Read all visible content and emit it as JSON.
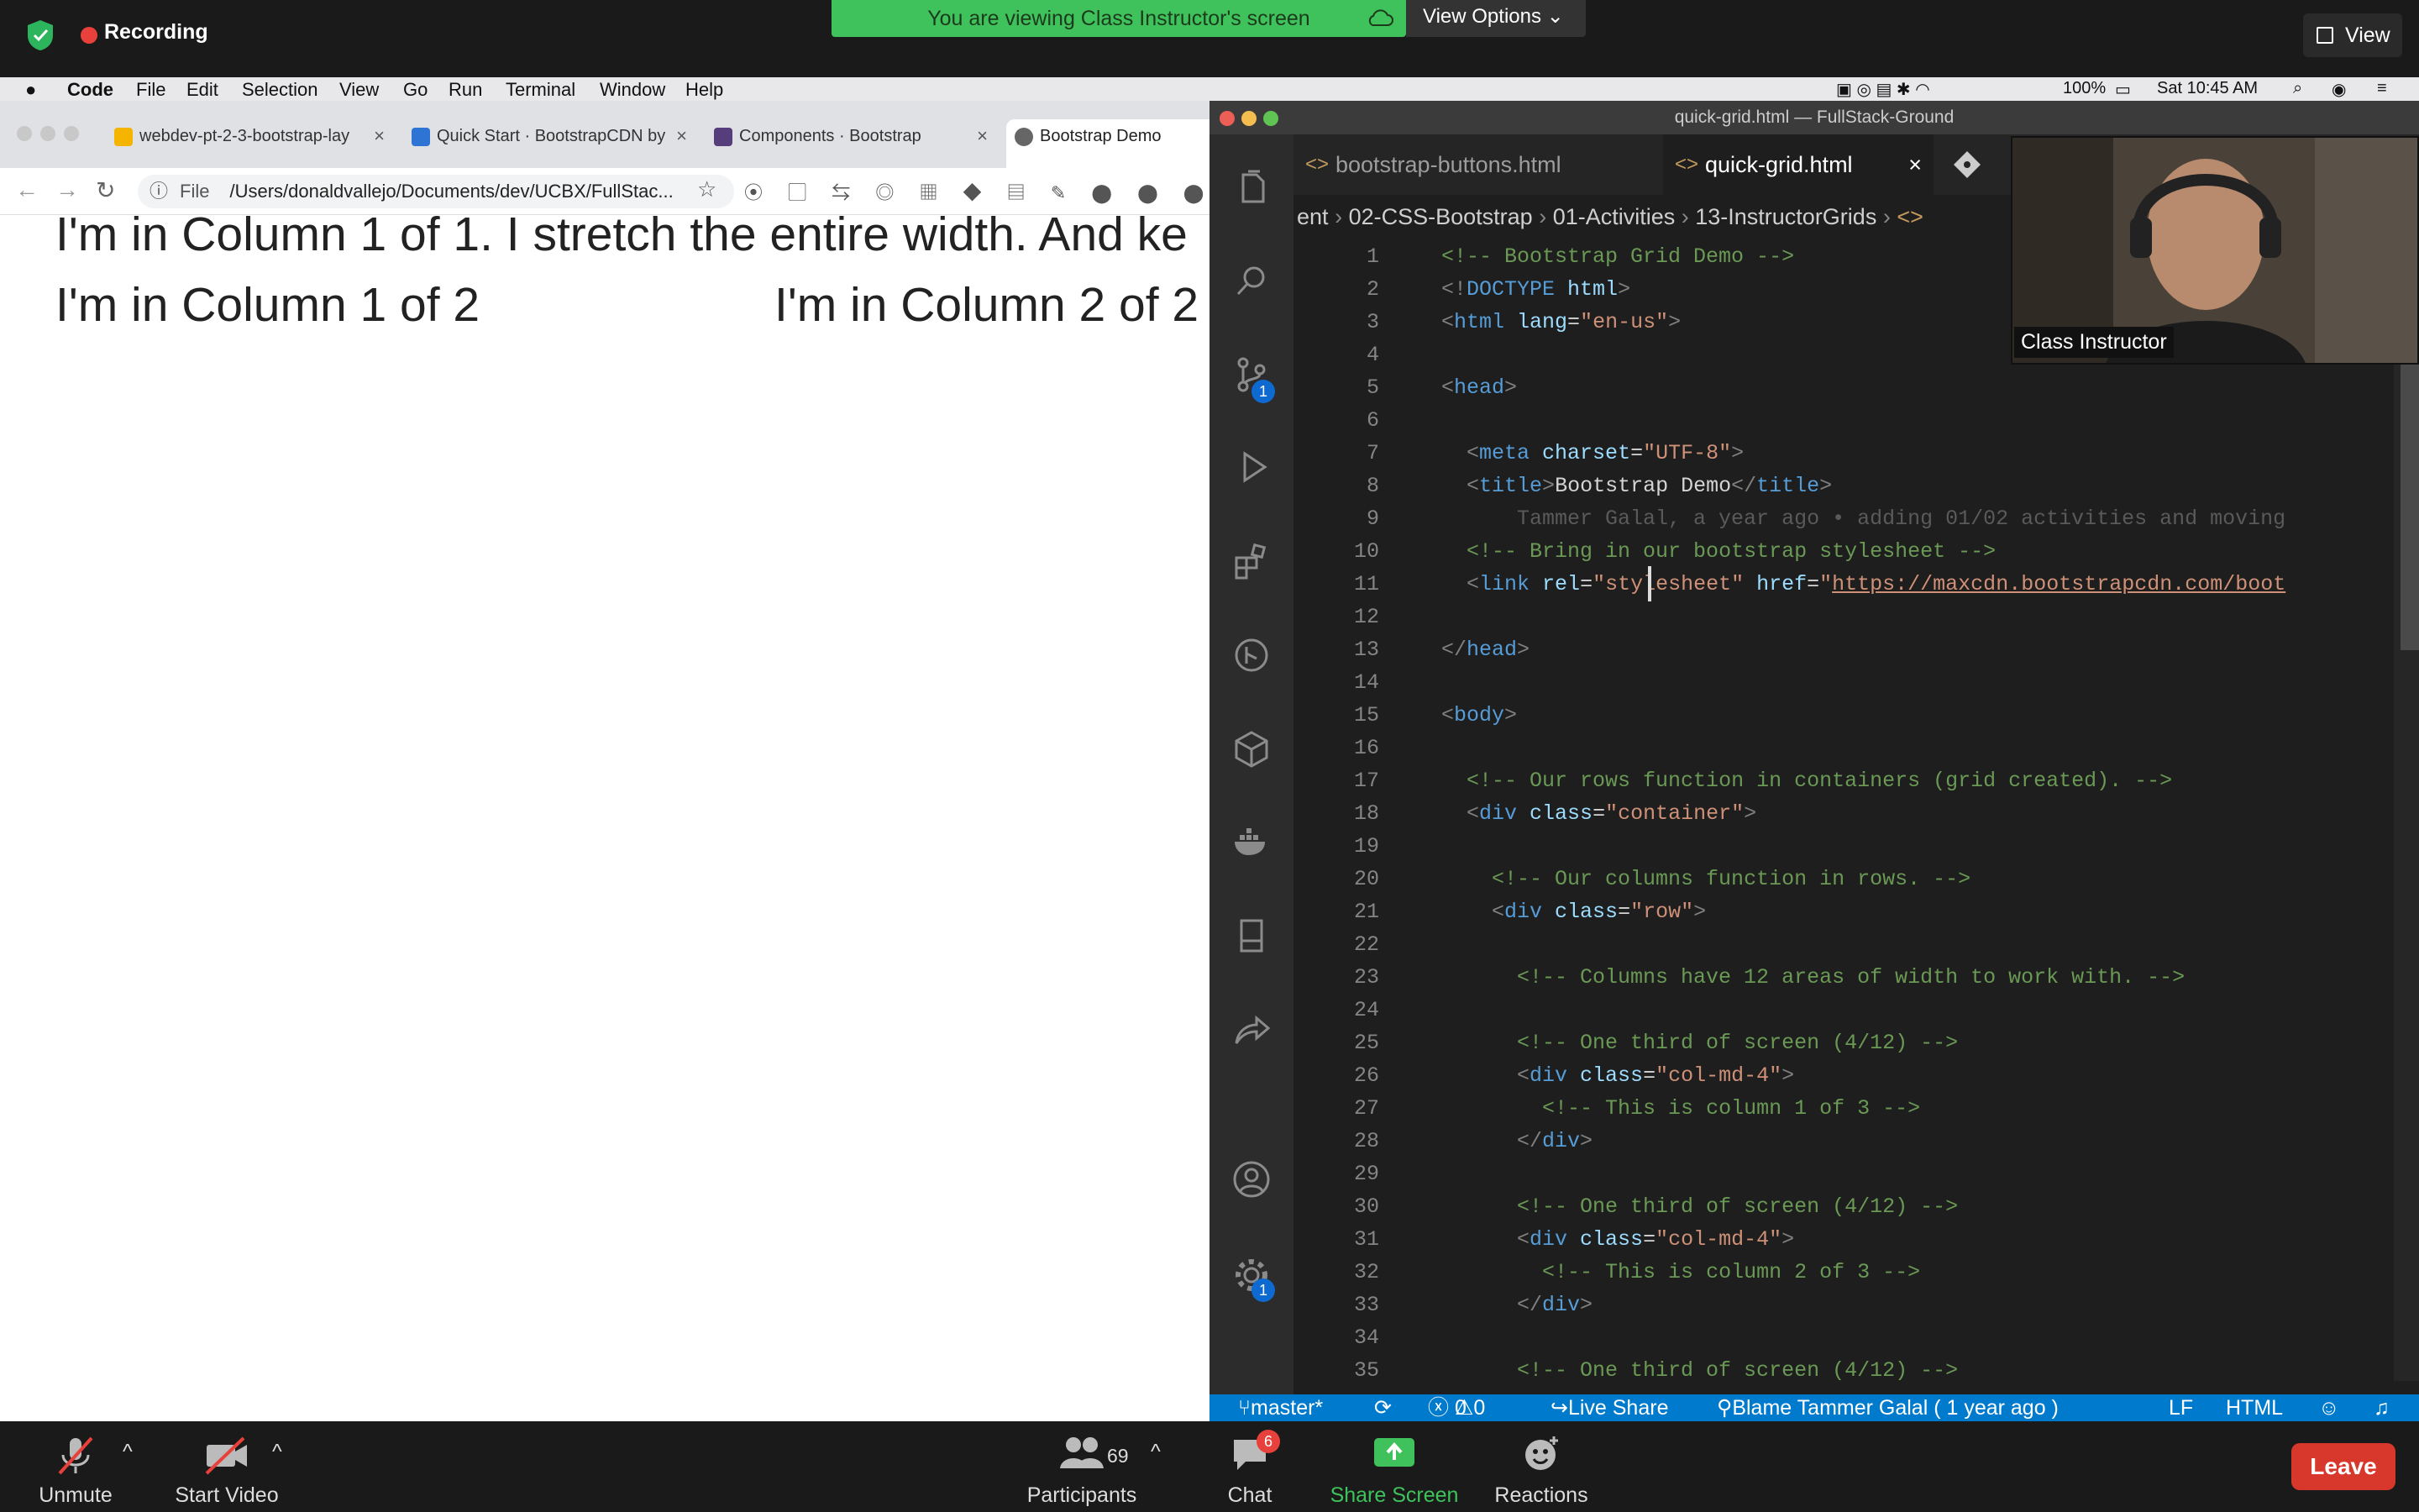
{
  "zoom_top": {
    "recording_label": "Recording",
    "viewing_banner": "You are viewing Class Instructor's screen",
    "view_options": "View Options",
    "view_button": "View"
  },
  "mac_menu": {
    "app": "Code",
    "items": [
      "File",
      "Edit",
      "Selection",
      "View",
      "Go",
      "Run",
      "Terminal",
      "Window",
      "Help"
    ],
    "battery": "100%",
    "clock": "Sat 10:45 AM"
  },
  "chrome": {
    "tabs": [
      {
        "label": "webdev-pt-2-3-bootstrap-lay"
      },
      {
        "label": "Quick Start · BootstrapCDN by"
      },
      {
        "label": "Components · Bootstrap"
      },
      {
        "label": "Bootstrap Demo"
      }
    ],
    "url_protocol": "File",
    "url": "/Users/donaldvallejo/Documents/dev/UCBX/FullStac...",
    "page_lines": [
      "I'm in Column 1 of 1. I stretch the entire width. And ke",
      "I'm in Column 1 of 2",
      "I'm in Column 2 of 2"
    ]
  },
  "vscode": {
    "window_title": "quick-grid.html — FullStack-Ground",
    "tabs": [
      "bootstrap-buttons.html",
      "quick-grid.html"
    ],
    "breadcrumbs": [
      "ent",
      "02-CSS-Bootstrap",
      "01-Activities",
      "13-InstructorGrids"
    ],
    "scm_badge": "1",
    "settings_badge": "1",
    "status": {
      "branch": "master*",
      "problems": "0",
      "warnings": "0",
      "liveshare": "Live Share",
      "blame": "Blame Tammer Galal ( 1 year ago )",
      "eol": "LF",
      "lang": "HTML"
    },
    "lines": [
      {
        "n": "1",
        "segs": [
          [
            "com",
            "<!-- Bootstrap Grid Demo -->"
          ]
        ]
      },
      {
        "n": "2",
        "segs": [
          [
            "tag",
            "<!"
          ],
          [
            "tn",
            "DOCTYPE"
          ],
          [
            "attr",
            " html"
          ],
          [
            "tag",
            ">"
          ]
        ]
      },
      {
        "n": "3",
        "segs": [
          [
            "tag",
            "<"
          ],
          [
            "tn",
            "html"
          ],
          [
            "attr",
            " lang"
          ],
          [
            "txt",
            "="
          ],
          [
            "str",
            "\"en-us\""
          ],
          [
            "tag",
            ">"
          ]
        ]
      },
      {
        "n": "4",
        "segs": []
      },
      {
        "n": "5",
        "segs": [
          [
            "tag",
            "<"
          ],
          [
            "tn",
            "head"
          ],
          [
            "tag",
            ">"
          ]
        ]
      },
      {
        "n": "6",
        "segs": []
      },
      {
        "n": "7",
        "segs": [
          [
            "txt",
            "  "
          ],
          [
            "tag",
            "<"
          ],
          [
            "tn",
            "meta"
          ],
          [
            "attr",
            " charset"
          ],
          [
            "txt",
            "="
          ],
          [
            "str",
            "\"UTF-8\""
          ],
          [
            "tag",
            ">"
          ]
        ]
      },
      {
        "n": "8",
        "segs": [
          [
            "txt",
            "  "
          ],
          [
            "tag",
            "<"
          ],
          [
            "tn",
            "title"
          ],
          [
            "tag",
            ">"
          ],
          [
            "txt",
            "Bootstrap Demo"
          ],
          [
            "tag",
            "</"
          ],
          [
            "tn",
            "title"
          ],
          [
            "tag",
            ">"
          ]
        ]
      },
      {
        "n": "9",
        "segs": [
          [
            "blame",
            "      Tammer Galal, a year ago • adding 01/02 activities and moving"
          ]
        ]
      },
      {
        "n": "10",
        "segs": [
          [
            "txt",
            "  "
          ],
          [
            "com",
            "<!-- Bring in our bootstrap stylesheet -->"
          ]
        ]
      },
      {
        "n": "11",
        "segs": [
          [
            "txt",
            "  "
          ],
          [
            "tag",
            "<"
          ],
          [
            "tn",
            "link"
          ],
          [
            "attr",
            " rel"
          ],
          [
            "txt",
            "="
          ],
          [
            "str",
            "\"stylesheet\""
          ],
          [
            "attr",
            " href"
          ],
          [
            "txt",
            "="
          ],
          [
            "str",
            "\""
          ],
          [
            "url",
            "https://maxcdn.bootstrapcdn.com/boot"
          ]
        ]
      },
      {
        "n": "12",
        "segs": []
      },
      {
        "n": "13",
        "segs": [
          [
            "tag",
            "</"
          ],
          [
            "tn",
            "head"
          ],
          [
            "tag",
            ">"
          ]
        ]
      },
      {
        "n": "14",
        "segs": []
      },
      {
        "n": "15",
        "segs": [
          [
            "tag",
            "<"
          ],
          [
            "tn",
            "body"
          ],
          [
            "tag",
            ">"
          ]
        ]
      },
      {
        "n": "16",
        "segs": []
      },
      {
        "n": "17",
        "segs": [
          [
            "txt",
            "  "
          ],
          [
            "com",
            "<!-- Our rows function in containers (grid created). -->"
          ]
        ]
      },
      {
        "n": "18",
        "segs": [
          [
            "txt",
            "  "
          ],
          [
            "tag",
            "<"
          ],
          [
            "tn",
            "div"
          ],
          [
            "attr",
            " class"
          ],
          [
            "txt",
            "="
          ],
          [
            "str",
            "\"container\""
          ],
          [
            "tag",
            ">"
          ]
        ]
      },
      {
        "n": "19",
        "segs": []
      },
      {
        "n": "20",
        "segs": [
          [
            "txt",
            "    "
          ],
          [
            "com",
            "<!-- Our columns function in rows. -->"
          ]
        ]
      },
      {
        "n": "21",
        "segs": [
          [
            "txt",
            "    "
          ],
          [
            "tag",
            "<"
          ],
          [
            "tn",
            "div"
          ],
          [
            "attr",
            " class"
          ],
          [
            "txt",
            "="
          ],
          [
            "str",
            "\"row\""
          ],
          [
            "tag",
            ">"
          ]
        ]
      },
      {
        "n": "22",
        "segs": []
      },
      {
        "n": "23",
        "segs": [
          [
            "txt",
            "      "
          ],
          [
            "com",
            "<!-- Columns have 12 areas of width to work with. -->"
          ]
        ]
      },
      {
        "n": "24",
        "segs": []
      },
      {
        "n": "25",
        "segs": [
          [
            "txt",
            "      "
          ],
          [
            "com",
            "<!-- One third of screen (4/12) -->"
          ]
        ]
      },
      {
        "n": "26",
        "segs": [
          [
            "txt",
            "      "
          ],
          [
            "tag",
            "<"
          ],
          [
            "tn",
            "div"
          ],
          [
            "attr",
            " class"
          ],
          [
            "txt",
            "="
          ],
          [
            "str",
            "\"col-md-4\""
          ],
          [
            "tag",
            ">"
          ]
        ]
      },
      {
        "n": "27",
        "segs": [
          [
            "txt",
            "        "
          ],
          [
            "com",
            "<!-- This is column 1 of 3 -->"
          ]
        ]
      },
      {
        "n": "28",
        "segs": [
          [
            "txt",
            "      "
          ],
          [
            "tag",
            "</"
          ],
          [
            "tn",
            "div"
          ],
          [
            "tag",
            ">"
          ]
        ]
      },
      {
        "n": "29",
        "segs": []
      },
      {
        "n": "30",
        "segs": [
          [
            "txt",
            "      "
          ],
          [
            "com",
            "<!-- One third of screen (4/12) -->"
          ]
        ]
      },
      {
        "n": "31",
        "segs": [
          [
            "txt",
            "      "
          ],
          [
            "tag",
            "<"
          ],
          [
            "tn",
            "div"
          ],
          [
            "attr",
            " class"
          ],
          [
            "txt",
            "="
          ],
          [
            "str",
            "\"col-md-4\""
          ],
          [
            "tag",
            ">"
          ]
        ]
      },
      {
        "n": "32",
        "segs": [
          [
            "txt",
            "        "
          ],
          [
            "com",
            "<!-- This is column 2 of 3 -->"
          ]
        ]
      },
      {
        "n": "33",
        "segs": [
          [
            "txt",
            "      "
          ],
          [
            "tag",
            "</"
          ],
          [
            "tn",
            "div"
          ],
          [
            "tag",
            ">"
          ]
        ]
      },
      {
        "n": "34",
        "segs": []
      },
      {
        "n": "35",
        "segs": [
          [
            "txt",
            "      "
          ],
          [
            "com",
            "<!-- One third of screen (4/12) -->"
          ]
        ]
      }
    ]
  },
  "video": {
    "name": "Class Instructor"
  },
  "zoom_bottom": {
    "unmute": "Unmute",
    "start_video": "Start Video",
    "participants": "Participants",
    "participants_count": "69",
    "chat": "Chat",
    "chat_badge": "6",
    "share_screen": "Share Screen",
    "reactions": "Reactions",
    "leave": "Leave"
  },
  "colors": {
    "zoom_green": "#3fc25b",
    "vscode_blue": "#007acc",
    "leave_red": "#d8382b"
  }
}
